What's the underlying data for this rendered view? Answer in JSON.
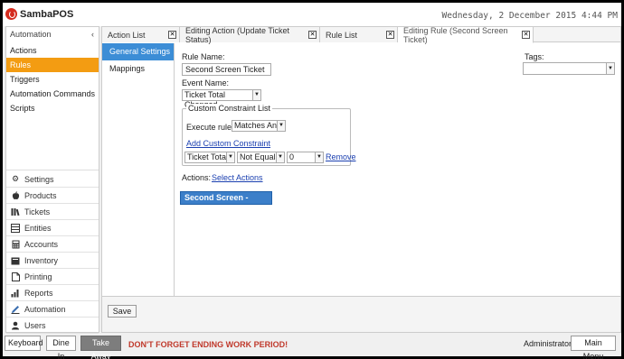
{
  "app": {
    "name": "SambaPOS",
    "datetime": "Wednesday, 2 December 2015 4:44 PM"
  },
  "sidebar": {
    "header": "Automation",
    "items": [
      {
        "label": "Actions"
      },
      {
        "label": "Rules"
      },
      {
        "label": "Triggers"
      },
      {
        "label": "Automation Commands"
      },
      {
        "label": "Scripts"
      }
    ],
    "nav": [
      {
        "label": "Settings",
        "icon": "gear-icon"
      },
      {
        "label": "Products",
        "icon": "apple-icon"
      },
      {
        "label": "Tickets",
        "icon": "tickets-icon"
      },
      {
        "label": "Entities",
        "icon": "entities-icon"
      },
      {
        "label": "Accounts",
        "icon": "calculator-icon"
      },
      {
        "label": "Inventory",
        "icon": "inventory-icon"
      },
      {
        "label": "Printing",
        "icon": "printer-icon"
      },
      {
        "label": "Reports",
        "icon": "bar-chart-icon"
      },
      {
        "label": "Automation",
        "icon": "pencil-icon"
      },
      {
        "label": "Users",
        "icon": "user-icon"
      }
    ]
  },
  "tabs": [
    {
      "label": "Action List"
    },
    {
      "label": "Editing Action (Update Ticket Status)"
    },
    {
      "label": "Rule List"
    },
    {
      "label": "Editing Rule (Second Screen Ticket)"
    }
  ],
  "vtabs": [
    {
      "label": "General Settings"
    },
    {
      "label": "Mappings"
    }
  ],
  "form": {
    "rule_name_label": "Rule Name:",
    "rule_name_value": "Second Screen Ticket",
    "tags_label": "Tags:",
    "tags_value": "",
    "event_name_label": "Event Name:",
    "event_name_value": "Ticket Total Changed",
    "constraint_group_title": "Custom Constraint List",
    "execute_rule_label": "Execute rule if",
    "execute_rule_value": "Matches Any",
    "add_constraint_link": "Add Custom Constraint",
    "constraint_field": "Ticket Total",
    "constraint_operator": "Not Equals",
    "constraint_value": "0",
    "remove_link": "Remove",
    "actions_label": "Actions:",
    "select_actions_link": "Select Actions",
    "action_item": "Second Screen - Ticket",
    "save_label": "Save"
  },
  "statusbar": {
    "keyboard": "Keyboard",
    "dine_in": "Dine In",
    "take_away": "Take Away",
    "warning": "DON'T FORGET ENDING WORK PERIOD!",
    "user": "Administrator",
    "main_menu": "Main Menu"
  }
}
